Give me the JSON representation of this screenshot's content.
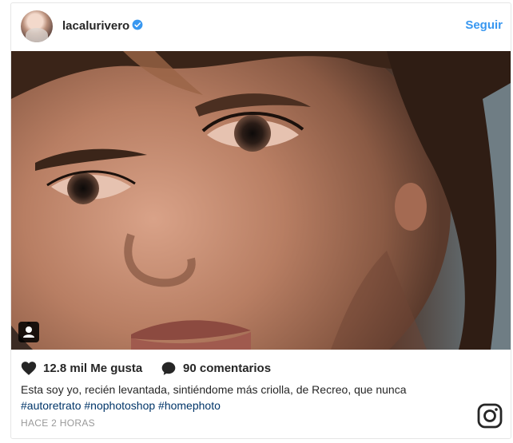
{
  "post": {
    "username": "lacalurivero",
    "follow_label": "Seguir",
    "likes": "12.8 mil Me gusta",
    "comments": "90 comentarios",
    "caption_line1": "Esta soy yo, recién levantada, sintiéndome más criolla, de Recreo, que nunca",
    "hashtags": "#autoretrato #nophotoshop #homephoto",
    "timestamp": "HACE 2 HORAS"
  },
  "icons": {
    "verified": "verified-badge-icon",
    "heart": "heart-icon",
    "comment": "comment-bubble-icon",
    "person_tag": "user-tag-icon",
    "brand": "instagram-logo-icon"
  },
  "colors": {
    "accent": "#3897f0",
    "hashtag": "#003569",
    "muted": "#999999"
  }
}
